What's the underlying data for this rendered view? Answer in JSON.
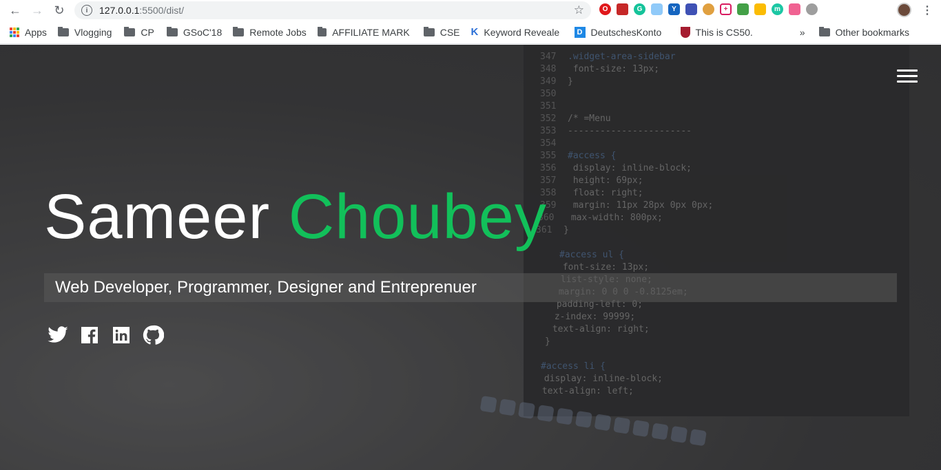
{
  "browser": {
    "url_host": "127.0.0.1",
    "url_path": ":5500/dist/",
    "bookmarks": [
      {
        "label": "Apps",
        "icon": "apps-grid-icon"
      },
      {
        "label": "Vlogging",
        "icon": "folder-icon"
      },
      {
        "label": "CP",
        "icon": "folder-icon"
      },
      {
        "label": "GSoC'18",
        "icon": "folder-icon"
      },
      {
        "label": "Remote Jobs",
        "icon": "folder-icon"
      },
      {
        "label": "AFFILIATE MARK",
        "icon": "folder-icon"
      },
      {
        "label": "CSE",
        "icon": "folder-icon"
      },
      {
        "label": "Keyword Reveale",
        "icon": "keyword-icon"
      },
      {
        "label": "DeutschesKonto",
        "icon": "d-icon"
      },
      {
        "label": "This is CS50.",
        "icon": "harvard-icon"
      }
    ],
    "more_label": "»",
    "other_bookmarks": "Other bookmarks"
  },
  "hero": {
    "first_name": "Sameer",
    "last_name": "Choubey",
    "tagline": "Web Developer, Programmer, Designer and Entreprenuer",
    "accent_color": "#12c05a",
    "socials": [
      "twitter-icon",
      "facebook-icon",
      "linkedin-icon",
      "github-icon"
    ]
  },
  "code_lines": [
    {
      "n": "347",
      "t": ".widget-area-sidebar"
    },
    {
      "n": "348",
      "t": "    font-size: 13px;"
    },
    {
      "n": "349",
      "t": "}"
    },
    {
      "n": "350",
      "t": ""
    },
    {
      "n": "351",
      "t": ""
    },
    {
      "n": "352",
      "t": "/* =Menu"
    },
    {
      "n": "353",
      "t": "-----------------------"
    },
    {
      "n": "354",
      "t": ""
    },
    {
      "n": "355",
      "t": "#access {"
    },
    {
      "n": "356",
      "t": "    display: inline-block;"
    },
    {
      "n": "357",
      "t": "    height: 69px;"
    },
    {
      "n": "358",
      "t": "    float: right;"
    },
    {
      "n": "359",
      "t": "    margin: 11px 28px 0px 0px;"
    },
    {
      "n": "360",
      "t": "    max-width: 800px;"
    },
    {
      "n": "361",
      "t": "}"
    },
    {
      "n": "",
      "t": ""
    },
    {
      "n": "",
      "t": "#access ul {"
    },
    {
      "n": "",
      "t": "    font-size: 13px;"
    },
    {
      "n": "",
      "t": "    list-style: none;"
    },
    {
      "n": "",
      "t": "    margin: 0 0 0 -0.8125em;"
    },
    {
      "n": "",
      "t": "    padding-left: 0;"
    },
    {
      "n": "",
      "t": "    z-index: 99999;"
    },
    {
      "n": "",
      "t": "    text-align: right;"
    },
    {
      "n": "",
      "t": "}"
    },
    {
      "n": "",
      "t": ""
    },
    {
      "n": "",
      "t": "#access li {"
    },
    {
      "n": "",
      "t": "    display: inline-block;"
    },
    {
      "n": "",
      "t": "    text-align: left;"
    }
  ]
}
